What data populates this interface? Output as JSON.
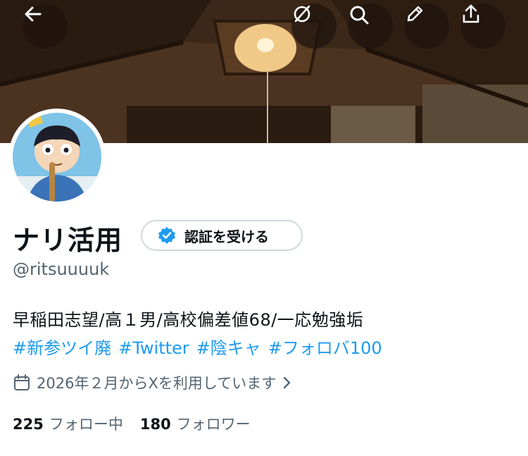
{
  "header": {
    "icons": [
      "arrow-left-icon",
      "grok-icon",
      "search-icon",
      "pencil-icon",
      "share-icon"
    ]
  },
  "profile": {
    "display_name": "ナリ活用",
    "verify_button_label": "認証を受ける",
    "handle": "@ritsuuuuk",
    "bio_line1": "早稲田志望/高１男/高校偏差値68/一応勉強垢",
    "hashtags": [
      "#新参ツイ廃",
      "#Twitter",
      "#陰キャ",
      "#フォロバ100"
    ],
    "joined": "2026年２月からXを利用しています",
    "following_count": "225",
    "following_label": "フォロー中",
    "followers_count": "180",
    "followers_label": "フォロワー"
  },
  "colors": {
    "accent": "#1d9bf0",
    "secondary_text": "#536471",
    "primary_text": "#0f1419",
    "border": "#cfd9de"
  }
}
